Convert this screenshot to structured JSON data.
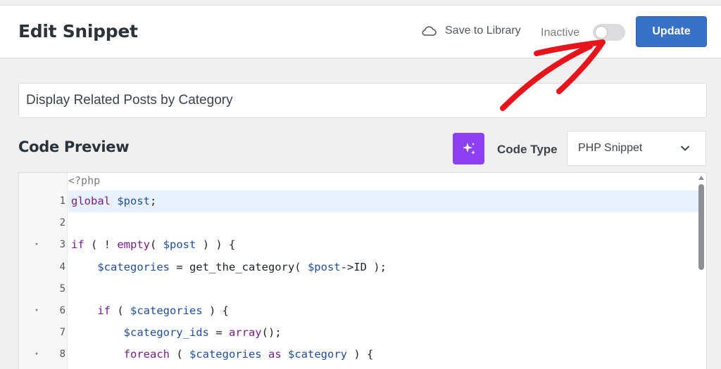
{
  "header": {
    "title": "Edit Snippet",
    "save_to_library": "Save to Library",
    "status_label": "Inactive",
    "toggle_state": "off",
    "update_label": "Update"
  },
  "snippet_title": "Display Related Posts by Category",
  "code_preview": {
    "title": "Code Preview",
    "code_type_label": "Code Type",
    "code_type_value": "PHP Snippet",
    "php_open_tag": "<?php",
    "lines": [
      {
        "num": "1",
        "fold": "",
        "tokens": [
          {
            "t": "kw",
            "v": "global"
          },
          {
            "t": "",
            "v": " "
          },
          {
            "t": "var",
            "v": "$post"
          },
          {
            "t": "",
            "v": ";"
          }
        ]
      },
      {
        "num": "2",
        "fold": "",
        "tokens": []
      },
      {
        "num": "3",
        "fold": "▾",
        "tokens": [
          {
            "t": "kw",
            "v": "if"
          },
          {
            "t": "",
            "v": " ( ! "
          },
          {
            "t": "kw",
            "v": "empty"
          },
          {
            "t": "",
            "v": "( "
          },
          {
            "t": "var",
            "v": "$post"
          },
          {
            "t": "",
            "v": " ) ) {"
          }
        ]
      },
      {
        "num": "4",
        "fold": "",
        "tokens": [
          {
            "t": "",
            "v": "    "
          },
          {
            "t": "var",
            "v": "$categories"
          },
          {
            "t": "",
            "v": " = get_the_category( "
          },
          {
            "t": "var",
            "v": "$post"
          },
          {
            "t": "",
            "v": "->ID );"
          }
        ]
      },
      {
        "num": "5",
        "fold": "",
        "tokens": []
      },
      {
        "num": "6",
        "fold": "▾",
        "tokens": [
          {
            "t": "",
            "v": "    "
          },
          {
            "t": "kw",
            "v": "if"
          },
          {
            "t": "",
            "v": " ( "
          },
          {
            "t": "var",
            "v": "$categories"
          },
          {
            "t": "",
            "v": " ) {"
          }
        ]
      },
      {
        "num": "7",
        "fold": "",
        "tokens": [
          {
            "t": "",
            "v": "        "
          },
          {
            "t": "var",
            "v": "$category_ids"
          },
          {
            "t": "",
            "v": " = "
          },
          {
            "t": "kw",
            "v": "array"
          },
          {
            "t": "",
            "v": "();"
          }
        ]
      },
      {
        "num": "8",
        "fold": "▾",
        "tokens": [
          {
            "t": "",
            "v": "        "
          },
          {
            "t": "kw",
            "v": "foreach"
          },
          {
            "t": "",
            "v": " ( "
          },
          {
            "t": "var",
            "v": "$categories"
          },
          {
            "t": "",
            "v": " "
          },
          {
            "t": "kw",
            "v": "as"
          },
          {
            "t": "",
            "v": " "
          },
          {
            "t": "var",
            "v": "$category"
          },
          {
            "t": "",
            "v": " ) {"
          }
        ]
      }
    ]
  },
  "icons": {
    "save_to_library": "cloud-icon",
    "ai": "sparkle-icon",
    "select": "chevron-down-icon",
    "annotation": "red-arrow-annotation"
  },
  "colors": {
    "accent": "#3871c8",
    "ai_button": "#8c3ff3",
    "annotation": "#e8141b",
    "keyword": "#7a1b8c",
    "variable": "#1f4e9e"
  }
}
